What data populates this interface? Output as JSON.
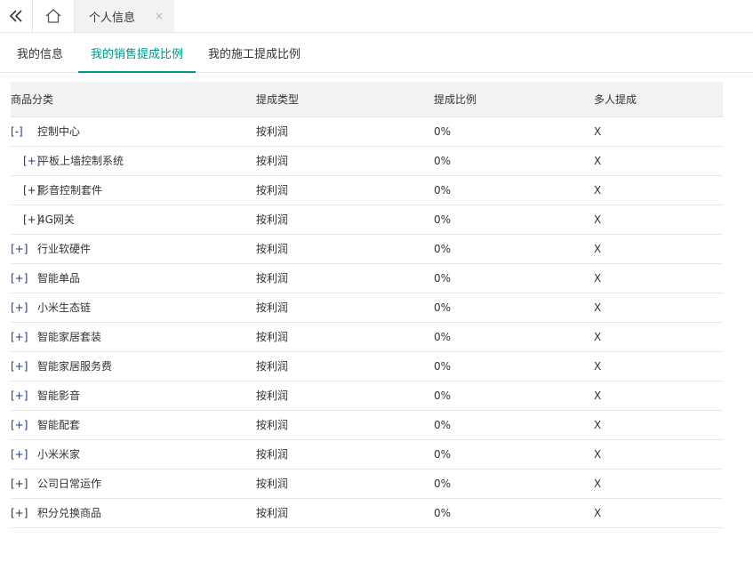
{
  "topbar": {
    "collapse_icon": "double-chevron-left-icon",
    "home_icon": "home-icon",
    "page_tab": {
      "label": "个人信息",
      "close": "×"
    }
  },
  "subtabs": [
    {
      "label": "我的信息",
      "active": false
    },
    {
      "label": "我的销售提成比例",
      "active": true
    },
    {
      "label": "我的施工提成比例",
      "active": false
    }
  ],
  "colors": {
    "accent": "#009688",
    "link": "#1e3a9c"
  },
  "table": {
    "headers": [
      "商品分类",
      "提成类型",
      "提成比例",
      "多人提成"
    ],
    "rows": [
      {
        "toggle": "[-]",
        "name": "控制中心",
        "type": "按利润",
        "ratio": "0%",
        "multi": "X"
      },
      {
        "toggle": "[+]",
        "name": "平板上墙控制系统",
        "type": "按利润",
        "ratio": "0%",
        "multi": "X"
      },
      {
        "toggle": "[+]",
        "name": "影音控制套件",
        "type": "按利润",
        "ratio": "0%",
        "multi": "X"
      },
      {
        "toggle": "[+]",
        "name": "4G网关",
        "type": "按利润",
        "ratio": "0%",
        "multi": "X"
      },
      {
        "toggle": "[+]",
        "name": "行业软硬件",
        "type": "按利润",
        "ratio": "0%",
        "multi": "X"
      },
      {
        "toggle": "[+]",
        "name": "智能单品",
        "type": "按利润",
        "ratio": "0%",
        "multi": "X"
      },
      {
        "toggle": "[+]",
        "name": "小米生态链",
        "type": "按利润",
        "ratio": "0%",
        "multi": "X"
      },
      {
        "toggle": "[+]",
        "name": "智能家居套装",
        "type": "按利润",
        "ratio": "0%",
        "multi": "X"
      },
      {
        "toggle": "[+]",
        "name": "智能家居服务费",
        "type": "按利润",
        "ratio": "0%",
        "multi": "X"
      },
      {
        "toggle": "[+]",
        "name": "智能影音",
        "type": "按利润",
        "ratio": "0%",
        "multi": "X"
      },
      {
        "toggle": "[+]",
        "name": "智能配套",
        "type": "按利润",
        "ratio": "0%",
        "multi": "X"
      },
      {
        "toggle": "[+]",
        "name": "小米米家",
        "type": "按利润",
        "ratio": "0%",
        "multi": "X"
      },
      {
        "toggle": "[+]",
        "name": "公司日常运作",
        "type": "按利润",
        "ratio": "0%",
        "multi": "X"
      },
      {
        "toggle": "[+]",
        "name": "积分兑换商品",
        "type": "按利润",
        "ratio": "0%",
        "multi": "X"
      }
    ]
  }
}
